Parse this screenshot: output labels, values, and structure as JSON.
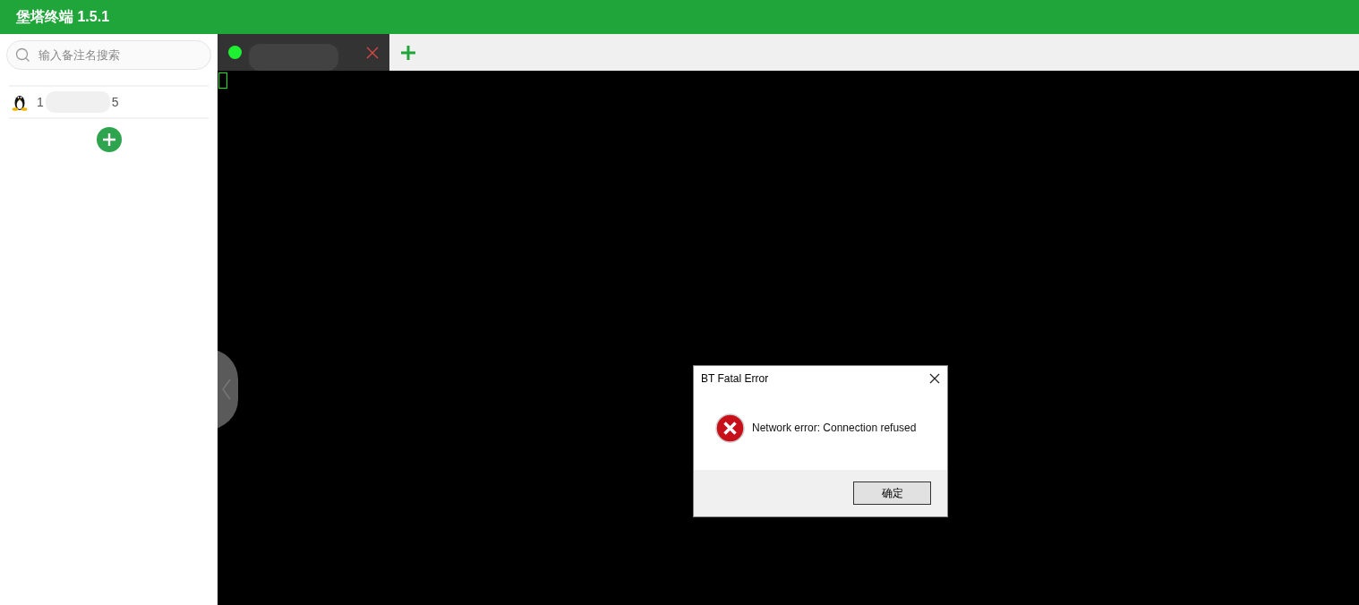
{
  "app": {
    "title": "堡塔终端 1.5.1"
  },
  "sidebar": {
    "search": {
      "placeholder": "输入备注名搜索"
    },
    "hosts": [
      {
        "label_start": "1",
        "label_end": "5",
        "selected": false
      }
    ]
  },
  "tabs": [
    {
      "connected": true,
      "selected": true
    }
  ],
  "dialog": {
    "title": "BT Fatal Error",
    "message": "Network error: Connection refused",
    "button": "确定"
  }
}
